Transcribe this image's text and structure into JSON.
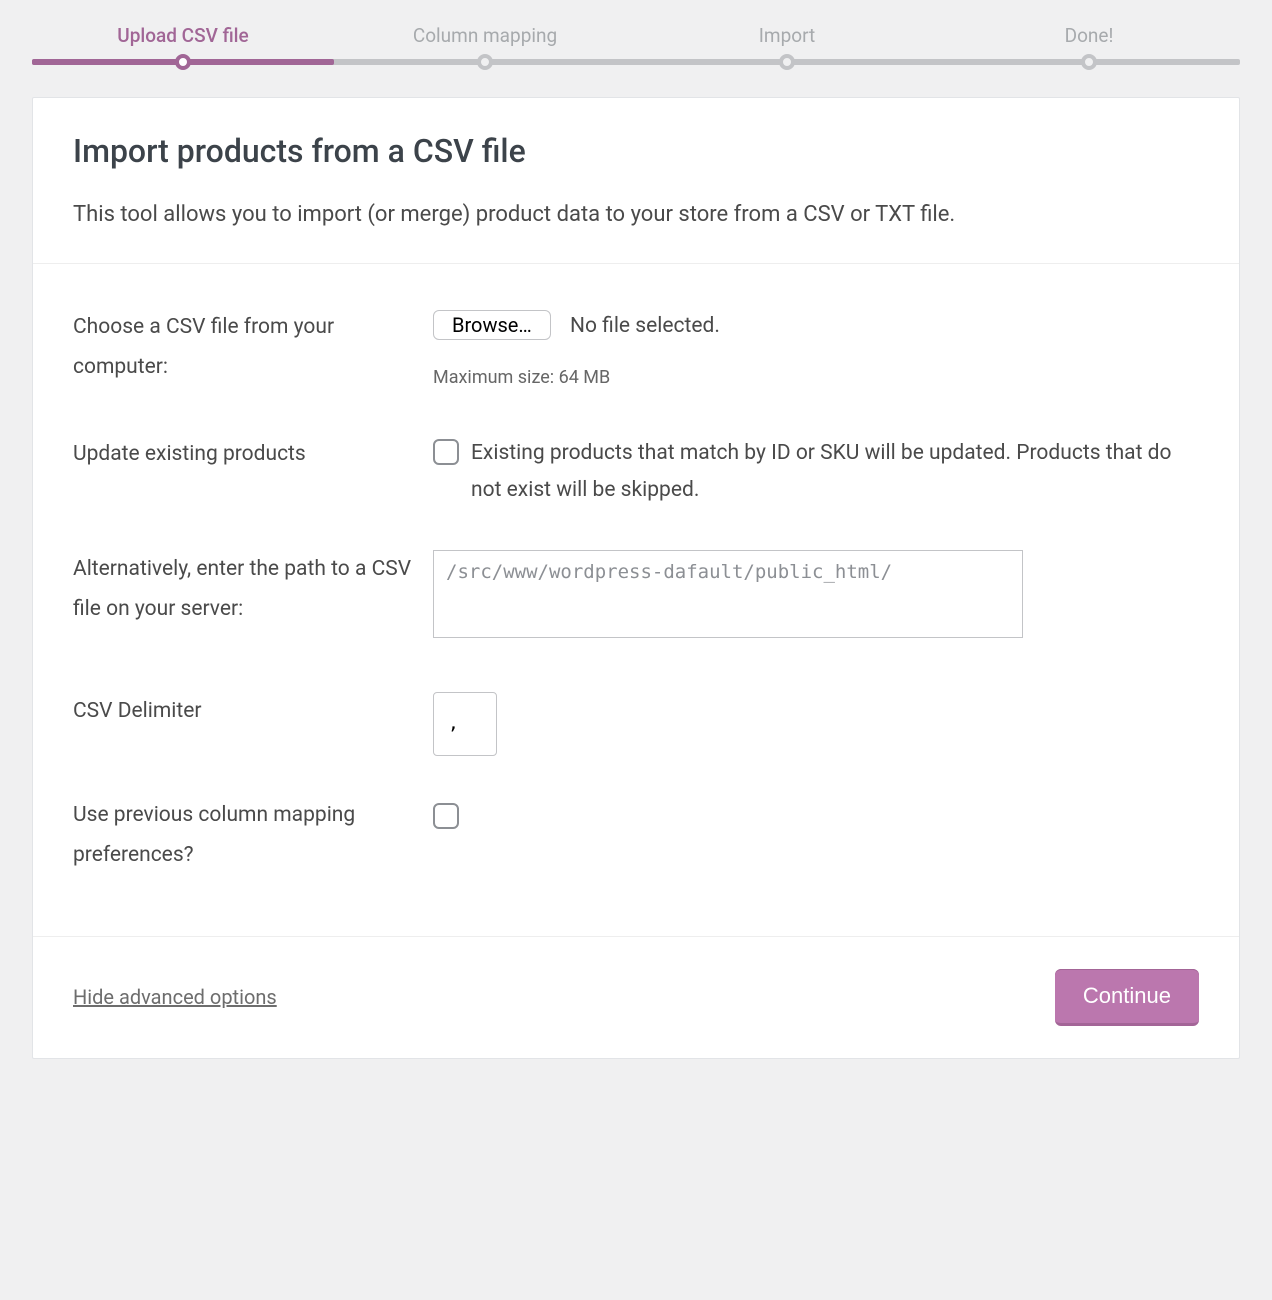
{
  "steps": {
    "s1": "Upload CSV file",
    "s2": "Column mapping",
    "s3": "Import",
    "s4": "Done!"
  },
  "header": {
    "title": "Import products from a CSV file",
    "desc": "This tool allows you to import (or merge) product data to your store from a CSV or TXT file."
  },
  "form": {
    "choose_label": "Choose a CSV file from your computer:",
    "browse_label": "Browse…",
    "no_file": "No file selected.",
    "max_size": "Maximum size: 64 MB",
    "update_label": "Update existing products",
    "update_desc": "Existing products that match by ID or SKU will be updated. Products that do not exist will be skipped.",
    "path_label": "Alternatively, enter the path to a CSV file on your server:",
    "path_value": "/src/www/wordpress-dafault/public_html/",
    "delim_label": "CSV Delimiter",
    "delim_value": ",",
    "prev_map_label": "Use previous column mapping preferences?"
  },
  "footer": {
    "advanced": "Hide advanced options",
    "continue": "Continue"
  }
}
